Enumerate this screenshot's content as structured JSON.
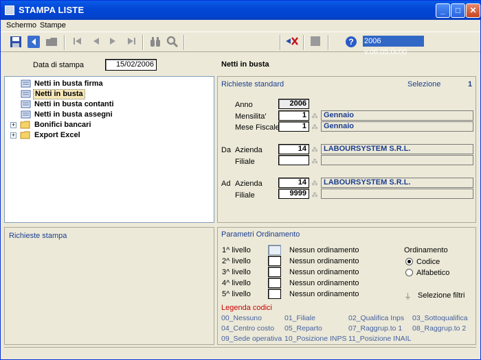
{
  "window": {
    "title": "STAMPA LISTE",
    "buttons": {
      "minimize": "_",
      "maximize": "□",
      "close": "✕"
    }
  },
  "menu": {
    "items": [
      "Schermo",
      "Stampe"
    ]
  },
  "toolbar": {
    "icons": [
      "save-icon",
      "back-icon",
      "folder-icon",
      "first-record-icon",
      "previous-record-icon",
      "next-record-icon",
      "last-record-icon",
      "binoculars-icon",
      "magnifier-icon",
      "flag-icon",
      "stop-icon",
      "help-icon"
    ],
    "version": "2006 v.06.05.0c00"
  },
  "header": {
    "date_label": "Data di stampa",
    "date_value": "15/02/2006",
    "page_title": "Netti in busta"
  },
  "tree": {
    "items": [
      {
        "label": "Netti in busta firma",
        "type": "report"
      },
      {
        "label": "Netti in busta",
        "type": "report",
        "selected": true
      },
      {
        "label": "Netti in busta contanti",
        "type": "report"
      },
      {
        "label": "Netti in busta assegni",
        "type": "report"
      },
      {
        "label": "Bonifici bancari",
        "type": "folder"
      },
      {
        "label": "Export Excel",
        "type": "folder"
      }
    ]
  },
  "standard": {
    "title": "Richieste standard",
    "selection_label": "Selezione",
    "selection_value": "1",
    "anno_label": "Anno",
    "anno_value": "2006",
    "mensilita_label": "Mensilita'",
    "mensilita_value": "1",
    "mensilita_desc": "Gennaio",
    "mese_label": "Mese Fiscale",
    "mese_value": "1",
    "mese_desc": "Gennaio",
    "da_prefix": "Da",
    "azienda_label": "Azienda",
    "da_azienda_value": "14",
    "da_azienda_desc": "LABOURSYSTEM S.R.L.",
    "filiale_label": "Filiale",
    "da_filiale_value": "",
    "ad_prefix": "Ad",
    "ad_azienda_value": "14",
    "ad_azienda_desc": "LABOURSYSTEM S.R.L.",
    "ad_filiale_value": "9999"
  },
  "requests": {
    "title": "Richieste stampa"
  },
  "ordering": {
    "title": "Parametri Ordinamento",
    "levels": [
      {
        "label": "1^ livello",
        "value": "Nessun ordinamento"
      },
      {
        "label": "2^ livello",
        "value": "Nessun ordinamento"
      },
      {
        "label": "3^ livello",
        "value": "Nessun ordinamento"
      },
      {
        "label": "4^ livello",
        "value": "Nessun ordinamento"
      },
      {
        "label": "5^ livello",
        "value": "Nessun ordinamento"
      }
    ],
    "sort_title": "Ordinamento",
    "sort_options": [
      "Codice",
      "Alfabetico"
    ],
    "sort_selected": "Codice",
    "filter_label": "Selezione filtri",
    "legend_title": "Legenda codici",
    "legend": [
      "00_Nessuno",
      "01_Filiale",
      "02_Qualifica Inps",
      "03_Sottoqualifica",
      "04_Centro costo",
      "05_Reparto",
      "07_Raggrup.to 1",
      "08_Raggrup.to 2",
      "09_Sede operativa",
      "10_Posizione INPS",
      "11_Posizione INAIL"
    ],
    "accent_color": "#cc0000"
  }
}
